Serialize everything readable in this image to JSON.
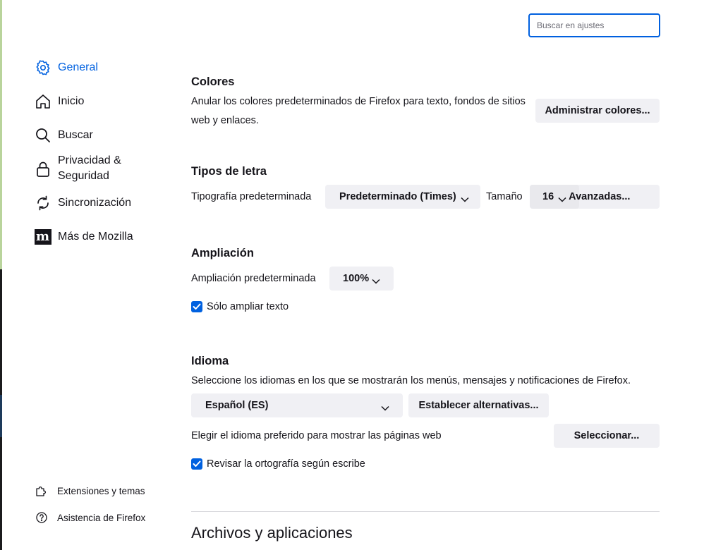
{
  "search": {
    "placeholder": "Buscar en ajustes"
  },
  "sidebar": {
    "items": [
      {
        "label": "General",
        "icon": "gear-icon",
        "selected": true
      },
      {
        "label": "Inicio",
        "icon": "home-icon"
      },
      {
        "label": "Buscar",
        "icon": "search-icon"
      },
      {
        "label": "Privacidad & Seguridad",
        "icon": "lock-icon"
      },
      {
        "label": "Sincronización",
        "icon": "sync-icon"
      },
      {
        "label": "Más de Mozilla",
        "icon": "mozilla-icon"
      }
    ],
    "footer": [
      {
        "label": "Extensiones y temas",
        "icon": "puzzle-icon"
      },
      {
        "label": "Asistencia de Firefox",
        "icon": "help-icon"
      }
    ]
  },
  "colors": {
    "title": "Colores",
    "description": "Anular los colores predeterminados de Firefox para texto, fondos de sitios web y enlaces.",
    "manage_button": "Administrar colores..."
  },
  "fonts": {
    "title": "Tipos de letra",
    "default_label": "Tipografía predeterminada",
    "default_value": "Predeterminado (Times)",
    "size_label": "Tamaño",
    "size_value": "16",
    "advanced_button": "Avanzadas..."
  },
  "zoom": {
    "title": "Ampliación",
    "default_label": "Ampliación predeterminada",
    "default_value": "100%",
    "text_only_label": "Sólo ampliar texto",
    "text_only_checked": true
  },
  "language": {
    "title": "Idioma",
    "description": "Seleccione los idiomas en los que se mostrarán los menús, mensajes y notificaciones de Firefox.",
    "ui_language": "Español (ES)",
    "alternatives_button": "Establecer alternativas...",
    "web_pages_label": "Elegir el idioma preferido para mostrar las páginas web",
    "select_button": "Seleccionar...",
    "spellcheck_label": "Revisar la ortografía según escribe",
    "spellcheck_checked": true
  },
  "files_section": {
    "title": "Archivos y aplicaciones"
  },
  "theme": {
    "accent": "#0061e0",
    "button_bg": "#f0f0f4",
    "text": "#15141a"
  }
}
